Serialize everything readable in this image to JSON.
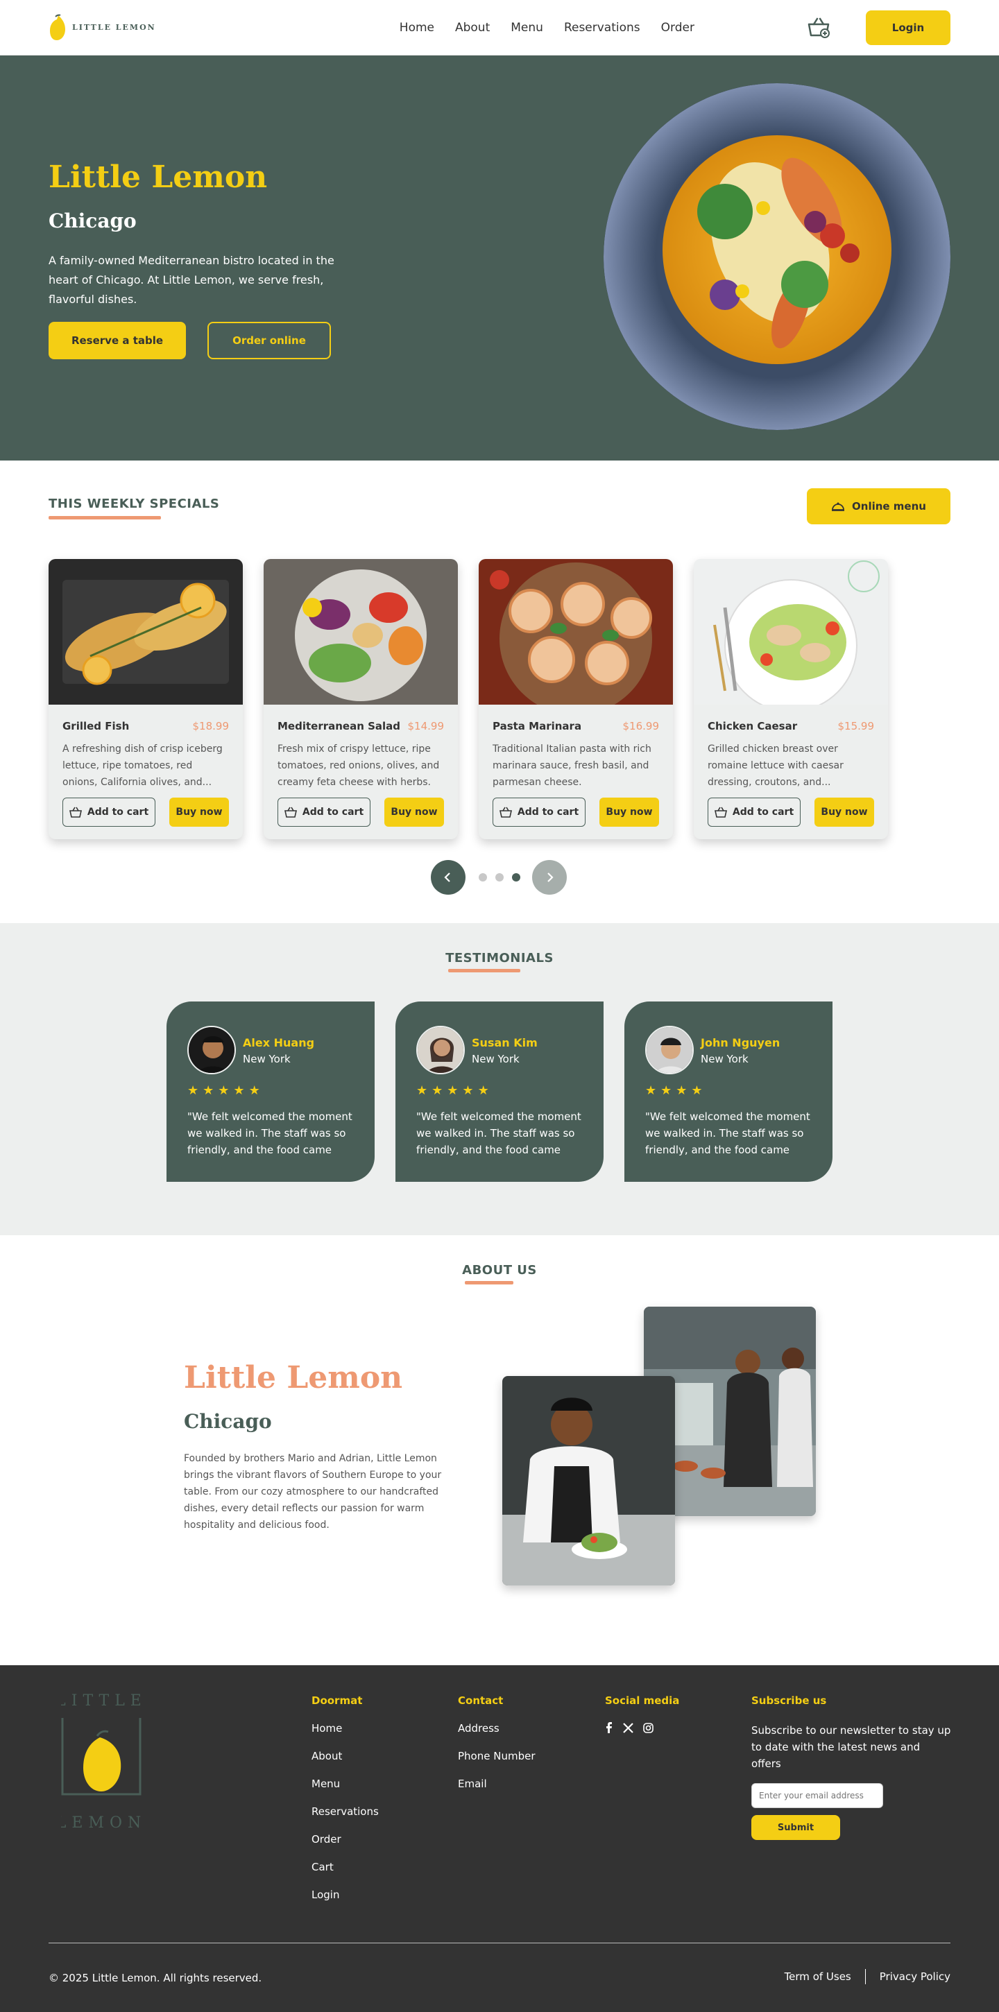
{
  "header": {
    "brand": "LITTLE LEMON",
    "nav": [
      "Home",
      "About",
      "Menu",
      "Reservations",
      "Order"
    ],
    "login_label": "Login"
  },
  "hero": {
    "title": "Little Lemon",
    "subtitle": "Chicago",
    "description": "A family-owned Mediterranean bistro located in the heart of Chicago. At Little Lemon, we serve fresh, flavorful dishes.",
    "reserve_label": "Reserve a table",
    "order_label": "Order online"
  },
  "specials": {
    "title": "THIS WEEKLY SPECIALS",
    "online_menu_label": "Online menu",
    "add_to_cart_label": "Add to cart",
    "buy_now_label": "Buy now",
    "items": [
      {
        "name": "Grilled Fish",
        "price": "$18.99",
        "description": "A refreshing dish of crisp iceberg lettuce, ripe tomatoes, red onions, California olives, and..."
      },
      {
        "name": "Mediterranean Salad",
        "price": "$14.99",
        "description": "Fresh mix of crispy lettuce, ripe tomatoes, red onions, olives, and creamy feta cheese with herbs."
      },
      {
        "name": "Pasta Marinara",
        "price": "$16.99",
        "description": "Traditional Italian pasta with rich marinara sauce, fresh basil, and parmesan cheese."
      },
      {
        "name": "Chicken Caesar",
        "price": "$15.99",
        "description": "Grilled chicken breast over romaine lettuce with caesar dressing, croutons, and..."
      }
    ],
    "carousel": {
      "pages": 3,
      "active_page": 3
    }
  },
  "testimonials": {
    "title": "TESTIMONIALS",
    "items": [
      {
        "name": "Alex Huang",
        "city": "New York",
        "rating": 5,
        "quote": "\"We felt welcomed the moment we walked in. The staff was so friendly, and the food came out..."
      },
      {
        "name": "Susan Kim",
        "city": "New York",
        "rating": 5,
        "quote": "\"We felt welcomed the moment we walked in. The staff was so friendly, and the food came out..."
      },
      {
        "name": "John Nguyen",
        "city": "New York",
        "rating": 5,
        "quote": "\"We felt welcomed the moment we walked in. The staff was so friendly, and the food came out..."
      }
    ]
  },
  "about": {
    "title": "ABOUT US",
    "name": "Little Lemon",
    "city": "Chicago",
    "description": "Founded by brothers Mario and Adrian, Little Lemon brings the vibrant flavors of Southern Europe to your table. From our cozy atmosphere to our handcrafted dishes, every detail reflects our passion for warm hospitality and delicious food."
  },
  "footer": {
    "logo_top": "LITTLE",
    "logo_bottom": "LEMON",
    "doormat": {
      "title": "Doormat",
      "links": [
        "Home",
        "About",
        "Menu",
        "Reservations",
        "Order",
        "Cart",
        "Login"
      ]
    },
    "contact": {
      "title": "Contact",
      "links": [
        "Address",
        "Phone Number",
        "Email"
      ]
    },
    "social": {
      "title": "Social media",
      "icons": [
        "facebook-icon",
        "x-icon",
        "instagram-icon"
      ]
    },
    "subscribe": {
      "title": "Subscribe us",
      "text": "Subscribe to our newsletter to stay up to date with the latest news and offers",
      "placeholder": "Enter your email address",
      "submit_label": "Submit"
    },
    "copyright": "© 2025 Little Lemon. All rights reserved.",
    "terms": "Term of Uses",
    "privacy": "Privacy Policy"
  },
  "colors": {
    "primary_green": "#495e57",
    "primary_yellow": "#f4ce14",
    "accent_salmon": "#ee9972",
    "light_gray": "#edefee",
    "footer_dark": "#333333"
  }
}
